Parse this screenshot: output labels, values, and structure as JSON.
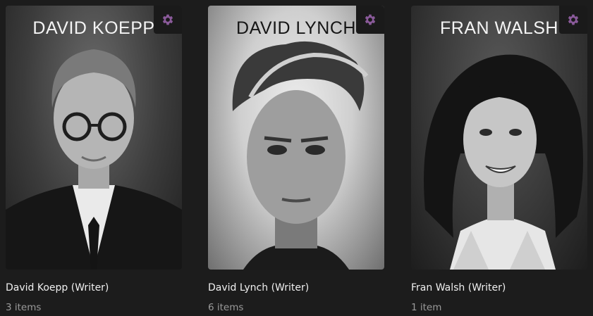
{
  "accent_color": "#8a5a9a",
  "items": [
    {
      "poster_name": "DAVID KOEPP",
      "title": "David Koepp (Writer)",
      "count": "3 items"
    },
    {
      "poster_name": "DAVID LYNCH",
      "title": "David Lynch (Writer)",
      "count": "6 items"
    },
    {
      "poster_name": "FRAN WALSH",
      "title": "Fran Walsh (Writer)",
      "count": "1 item"
    }
  ],
  "icons": {
    "settings": "gear-icon"
  }
}
